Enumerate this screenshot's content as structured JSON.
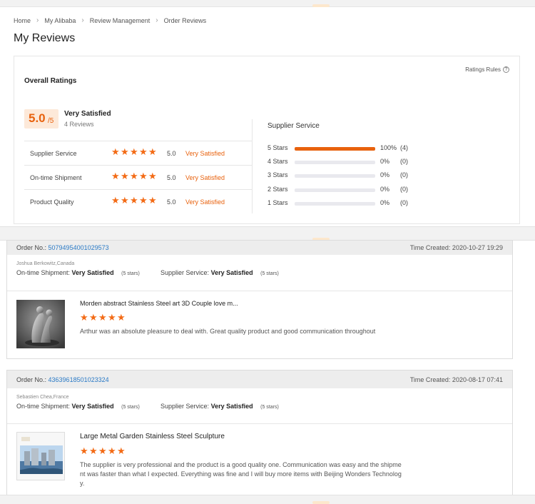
{
  "breadcrumb": [
    "Home",
    "My Alibaba",
    "Review Management",
    "Order Reviews"
  ],
  "page_title": "My Reviews",
  "overall": {
    "title": "Overall Ratings",
    "rules_label": "Ratings Rules",
    "score": "5.0",
    "score_den": "/5",
    "summary_label": "Very Satisfied",
    "summary_count": "4 Reviews",
    "rows": [
      {
        "label": "Supplier Service",
        "value": "5.0",
        "text": "Very Satisfied",
        "stars": 5
      },
      {
        "label": "On-time Shipment",
        "value": "5.0",
        "text": "Very Satisfied",
        "stars": 5
      },
      {
        "label": "Product Quality",
        "value": "5.0",
        "text": "Very Satisfied",
        "stars": 5
      }
    ]
  },
  "service": {
    "title": "Supplier Service",
    "distribution": [
      {
        "label": "5 Stars",
        "pct": "100%",
        "count": "(4)",
        "fill": 1.0
      },
      {
        "label": "4 Stars",
        "pct": "0%",
        "count": "(0)",
        "fill": 0
      },
      {
        "label": "3 Stars",
        "pct": "0%",
        "count": "(0)",
        "fill": 0
      },
      {
        "label": "2 Stars",
        "pct": "0%",
        "count": "(0)",
        "fill": 0
      },
      {
        "label": "1 Stars",
        "pct": "0%",
        "count": "(0)",
        "fill": 0
      }
    ]
  },
  "orders": [
    {
      "order_label": "Order No.:",
      "order_no": "50794954001029573",
      "time": "Time Created: 2020-10-27 19:29",
      "buyer": "Joshua Berkowitz,Canada",
      "shipment_label": "On-time Shipment:",
      "shipment_value": "Very Satisfied",
      "shipment_stars": "(5 stars)",
      "service_label": "Supplier Service:",
      "service_value": "Very Satisfied",
      "service_stars": "(5 stars)",
      "product": "Morden abstract Stainless Steel art 3D Couple love m...",
      "rating": 5,
      "review": "Arthur was an absolute pleasure to deal with. Great quality product and good communication throughout"
    },
    {
      "order_label": "Order No.:",
      "order_no": "43639618501023324",
      "time": "Time Created: 2020-08-17 07:41",
      "buyer": "Sebastien Chea,France",
      "shipment_label": "On-time Shipment:",
      "shipment_value": "Very Satisfied",
      "shipment_stars": "(5 stars)",
      "service_label": "Supplier Service:",
      "service_value": "Very Satisfied",
      "service_stars": "(5 stars)",
      "product": "Large Metal Garden Stainless Steel Sculpture",
      "rating": 5,
      "review": "The supplier is very professional and the product is a good quality one. Communication was easy and the shipment was faster than what I expected. Everything was fine and I will buy more items with Beijing Wonders Technology."
    }
  ],
  "colors": {
    "accent": "#e8620e",
    "star": "#f36b16",
    "link": "#2a7ac6"
  }
}
